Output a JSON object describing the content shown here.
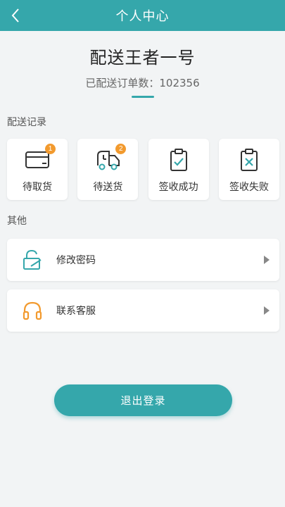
{
  "header": {
    "title": "个人中心"
  },
  "profile": {
    "name": "配送王者一号",
    "orders_label": "已配送订单数：",
    "orders_count": "102356"
  },
  "sections": {
    "records": "配送记录",
    "others": "其他"
  },
  "cards": [
    {
      "label": "待取货",
      "badge": "1",
      "icon": "box-icon"
    },
    {
      "label": "待送货",
      "badge": "2",
      "icon": "delivery-truck-icon"
    },
    {
      "label": "签收成功",
      "badge": "",
      "icon": "clipboard-check-icon"
    },
    {
      "label": "签收失败",
      "badge": "",
      "icon": "clipboard-x-icon"
    }
  ],
  "rows": [
    {
      "label": "修改密码",
      "icon": "unlock-icon"
    },
    {
      "label": "联系客服",
      "icon": "headphones-icon"
    }
  ],
  "logout": {
    "label": "退出登录"
  },
  "colors": {
    "primary": "#35a7ab",
    "badge": "#f29a2e",
    "headphones": "#f29a2e",
    "background": "#f2f4f5"
  }
}
